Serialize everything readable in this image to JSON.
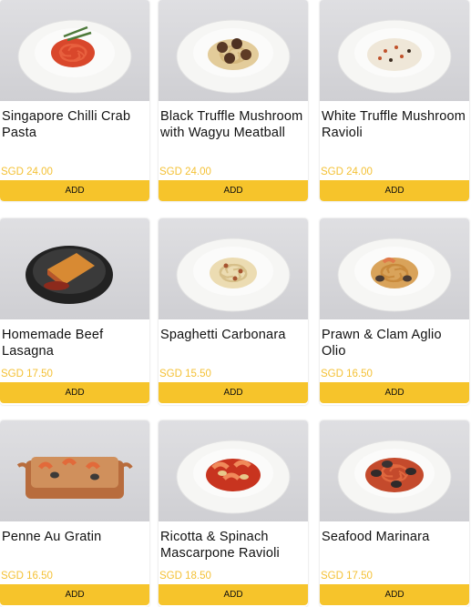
{
  "menu": {
    "add_label": "ADD",
    "items": [
      {
        "name": "Singapore Chilli Crab Pasta",
        "price": "SGD 24.00",
        "dish": "red-pasta"
      },
      {
        "name": "Black Truffle Mushroom with Wagyu Meatball",
        "price": "SGD 24.00",
        "dish": "meatball-pasta"
      },
      {
        "name": "White Truffle Mushroom Ravioli",
        "price": "SGD 24.00",
        "dish": "cream-ravioli"
      },
      {
        "name": "Homemade Beef Lasagna",
        "price": "SGD 17.50",
        "dish": "lasagna"
      },
      {
        "name": "Spaghetti Carbonara",
        "price": "SGD 15.50",
        "dish": "carbonara"
      },
      {
        "name": "Prawn & Clam Aglio Olio",
        "price": "SGD 16.50",
        "dish": "aglio-olio"
      },
      {
        "name": "Penne Au Gratin",
        "price": "SGD 16.50",
        "dish": "penne-gratin"
      },
      {
        "name": "Ricotta & Spinach Mascarpone Ravioli",
        "price": "SGD 18.50",
        "dish": "tomato-ravioli"
      },
      {
        "name": "Seafood Marinara",
        "price": "SGD 17.50",
        "dish": "marinara"
      }
    ]
  },
  "colors": {
    "accent": "#f6c42b",
    "price": "#f4c135"
  }
}
